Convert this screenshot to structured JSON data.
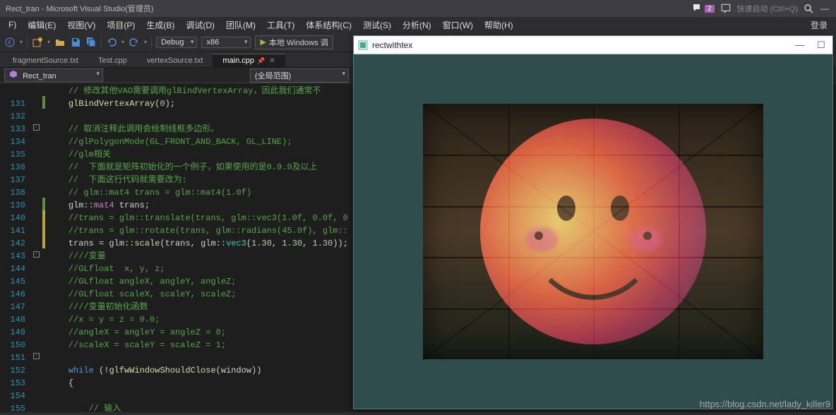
{
  "title": "Rect_tran - Microsoft Visual Studio(管理员)",
  "notification_count": "2",
  "quick_launch": "快速启动 (Ctrl+Q)",
  "login_label": "登录",
  "menu": [
    "F)",
    "编辑(E)",
    "视图(V)",
    "项目(P)",
    "生成(B)",
    "调试(D)",
    "团队(M)",
    "工具(T)",
    "体系结构(C)",
    "测试(S)",
    "分析(N)",
    "窗口(W)",
    "帮助(H)"
  ],
  "toolbar": {
    "config": "Debug",
    "platform": "x86",
    "run_label": "本地 Windows 调"
  },
  "tabs": [
    {
      "label": "fragmentSource.txt",
      "active": false
    },
    {
      "label": "Test.cpp",
      "active": false
    },
    {
      "label": "vertexSource.txt",
      "active": false
    },
    {
      "label": "main.cpp",
      "active": true
    }
  ],
  "nav": {
    "left": "Rect_tran",
    "right": "(全局范围)"
  },
  "lines": [
    {
      "n": "",
      "html": "    <span class='c-comment'>// 修改其他VAO需要调用glBindVertexArray，因此我们通常不</span>"
    },
    {
      "n": "131",
      "html": "    <span class='c-func'>glBindVertexArray</span><span class='c-op'>(</span><span class='c-num'>0</span><span class='c-op'>);</span>"
    },
    {
      "n": "132",
      "html": ""
    },
    {
      "n": "133",
      "html": "    <span class='c-comment'>// 取消注释此调用会绘制线框多边形。</span>"
    },
    {
      "n": "134",
      "html": "    <span class='c-comment'>//glPolygonMode(GL_FRONT_AND_BACK, GL_LINE);</span>"
    },
    {
      "n": "135",
      "html": "    <span class='c-comment'>//glm相关</span>"
    },
    {
      "n": "136",
      "html": "    <span class='c-comment'>//  下面就是矩阵初始化的一个例子，如果使用的是0.9.9及以上</span>"
    },
    {
      "n": "137",
      "html": "    <span class='c-comment'>//  下面这行代码就需要改为:</span>"
    },
    {
      "n": "138",
      "html": "    <span class='c-comment'>// glm::mat4 trans = glm::mat4(1.0f)</span>"
    },
    {
      "n": "139",
      "html": "    <span class='c-default'>glm::</span><span class='c-type2'>mat4</span><span class='c-default'> trans;</span>"
    },
    {
      "n": "140",
      "html": "    <span class='c-comment'>//trans = glm::translate(trans, glm::vec3(1.0f, 0.0f, 0</span>"
    },
    {
      "n": "141",
      "html": "    <span class='c-comment'>//trans = glm::rotate(trans, glm::radians(45.0f), glm::</span>"
    },
    {
      "n": "142",
      "html": "    <span class='c-default'>trans = glm::</span><span class='c-func'>scale</span><span class='c-op'>(</span><span class='c-default'>trans, glm::</span><span class='c-type'>vec3</span><span class='c-op'>(</span><span class='c-num'>1.30</span><span class='c-op'>, </span><span class='c-num'>1.30</span><span class='c-op'>, </span><span class='c-num'>1.30</span><span class='c-op'>));</span>"
    },
    {
      "n": "143",
      "html": "    <span class='c-comment'>////变量</span>"
    },
    {
      "n": "144",
      "html": "    <span class='c-comment'>//GLfloat  x, y, z;</span>"
    },
    {
      "n": "145",
      "html": "    <span class='c-comment'>//GLfloat angleX, angleY, angleZ;</span>"
    },
    {
      "n": "146",
      "html": "    <span class='c-comment'>//GLfloat scaleX, scaleY, scaleZ;</span>"
    },
    {
      "n": "147",
      "html": "    <span class='c-comment'>////变量初始化函数</span>"
    },
    {
      "n": "148",
      "html": "    <span class='c-comment'>//x = y = z = 0.0;</span>"
    },
    {
      "n": "149",
      "html": "    <span class='c-comment'>//angleX = angleY = angleZ = 0;</span>"
    },
    {
      "n": "150",
      "html": "    <span class='c-comment'>//scaleX = scaleY = scaleZ = 1;</span>"
    },
    {
      "n": "151",
      "html": ""
    },
    {
      "n": "152",
      "html": "    <span class='c-keyword'>while</span> <span class='c-op'>(!</span><span class='c-func'>glfwWindowShouldClose</span><span class='c-op'>(</span><span class='c-default'>window</span><span class='c-op'>))</span>"
    },
    {
      "n": "153",
      "html": "    <span class='c-op'>{</span>"
    },
    {
      "n": "154",
      "html": ""
    },
    {
      "n": "155",
      "html": "        <span class='c-comment'>// 输入</span>"
    }
  ],
  "fold_rows": [
    "",
    "",
    "",
    "-",
    "",
    "",
    "",
    "",
    "",
    "",
    "",
    "",
    "",
    "-",
    "",
    "",
    "",
    "",
    "",
    "",
    "",
    "-",
    "",
    "",
    ""
  ],
  "change_rows": [
    "",
    "g",
    "",
    "",
    "",
    "",
    "",
    "",
    "",
    "g",
    "y",
    "y",
    "y",
    "",
    "",
    "",
    "",
    "",
    "",
    "",
    "",
    "",
    "",
    "",
    ""
  ],
  "output_window": {
    "title": "rectwithtex"
  },
  "watermark": "https://blog.csdn.net/lady_killer9"
}
